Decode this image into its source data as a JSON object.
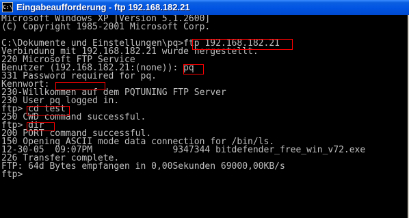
{
  "window": {
    "title": "Eingabeaufforderung - ftp 192.168.182.21",
    "icon": "cmd-icon",
    "icon_glyph": "C:\\"
  },
  "console": {
    "lines": [
      "Microsoft Windows XP [Version 5.1.2600]",
      "(C) Copyright 1985-2001 Microsoft Corp.",
      "",
      "C:\\Dokumente und Einstellungen\\pq>ftp 192.168.182.21",
      "Verbindung mit 192.168.182.21 wurde hergestellt.",
      "220 Microsoft FTP Service",
      "Benutzer (192.168.182.21:(none)): pq",
      "331 Password required for pq.",
      "Kennwort:",
      "230-Willkommen auf dem PQTUNING FTP Server",
      "230 User pq logged in.",
      "ftp> cd test",
      "250 CWD command successful.",
      "ftp> dir",
      "200 PORT command successful.",
      "150 Opening ASCII mode data connection for /bin/ls.",
      "12-30-05  09:07PM               9347344 bitdefender_free_win_v72.exe",
      "226 Transfer complete.",
      "FTP: 64d Bytes empfangen in 0,00Sekunden 69000,00KB/s",
      "ftp>"
    ]
  },
  "colors": {
    "title_bar": "#0054e3",
    "console_bg": "#000000",
    "console_text": "#c0c0c0",
    "highlight": "#ff0000"
  }
}
